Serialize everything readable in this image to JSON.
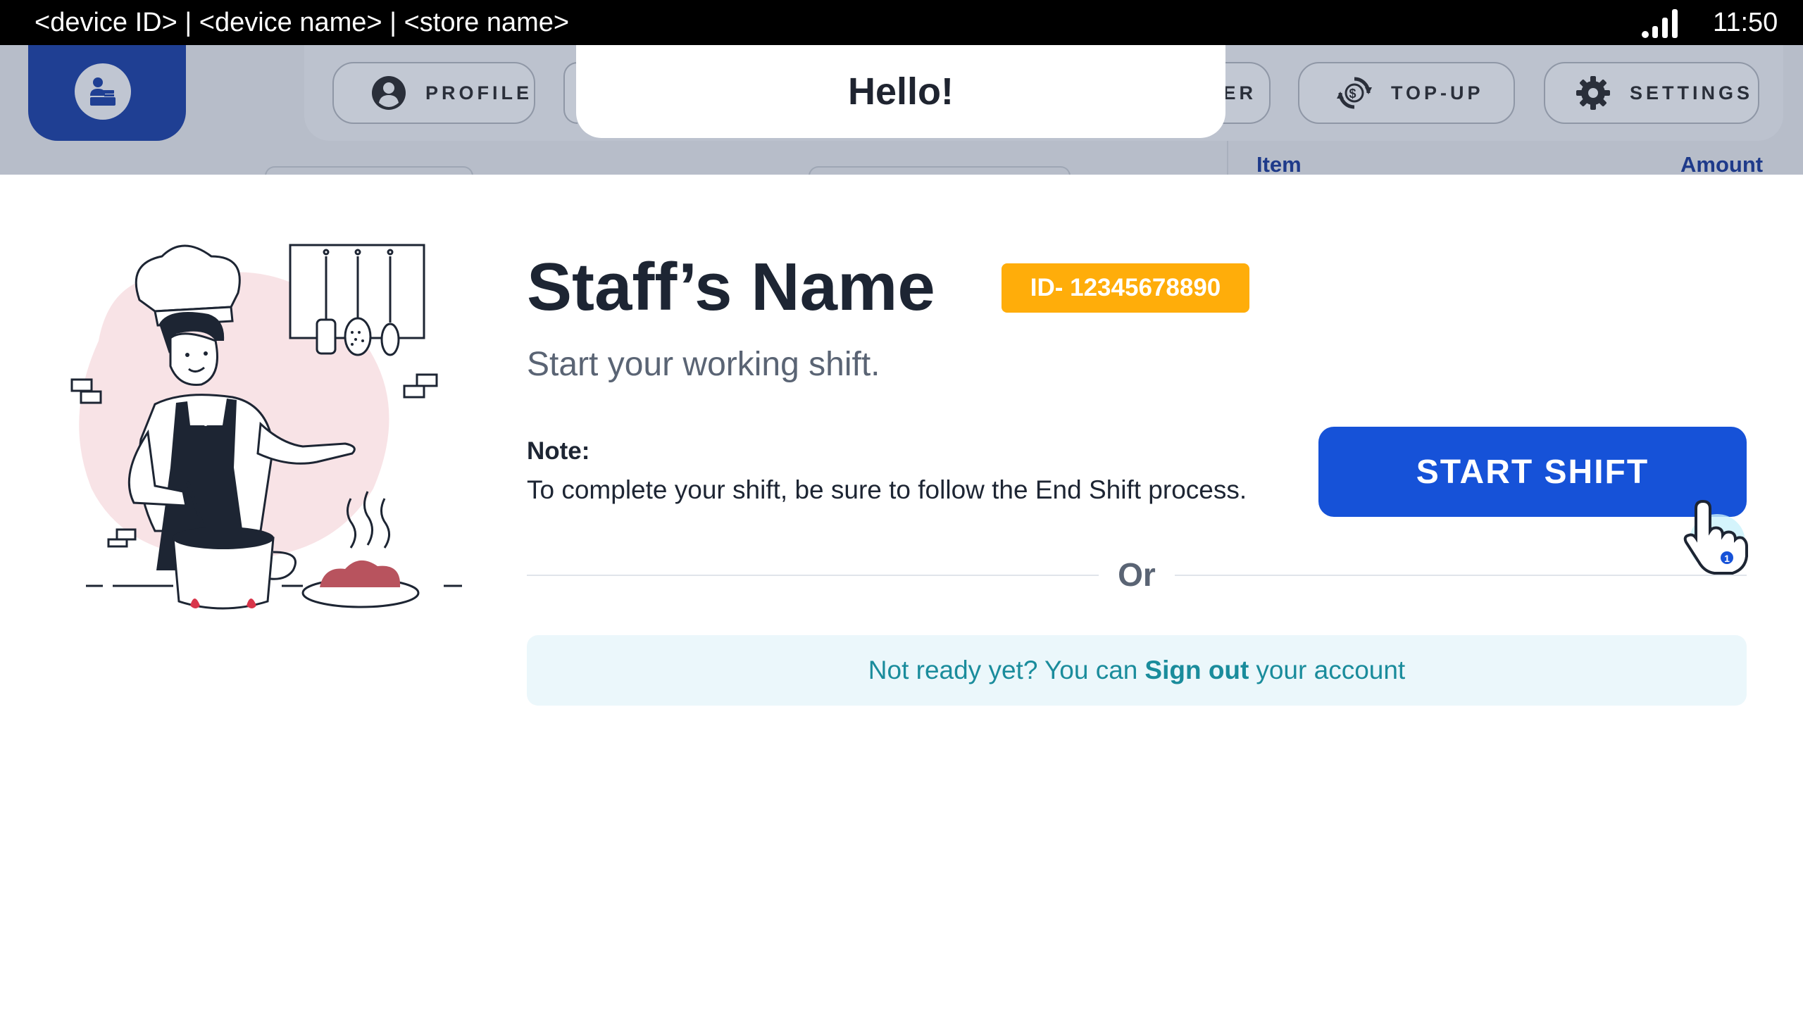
{
  "status_bar": {
    "device_info": "<device ID> | <device name> | <store name>",
    "time": "11:50"
  },
  "background_app": {
    "nav": {
      "profile_label": "PROFILE",
      "order_label_partial": "DER",
      "topup_label": "TOP-UP",
      "settings_label": "SETTINGS"
    },
    "order_columns": {
      "item": "Item",
      "amount": "Amount"
    }
  },
  "greeting": "Hello!",
  "shift": {
    "staff_name": "Staff’s Name",
    "staff_id": "ID- 12345678890",
    "subtitle": "Start your working shift.",
    "note_label": "Note:",
    "note_text": "To complete your shift, be sure to follow the End Shift process.",
    "start_button": "START SHIFT",
    "or_text": "Or",
    "signout_prefix": "Not ready yet? You can",
    "signout_link": "Sign out",
    "signout_suffix": "your account"
  },
  "colors": {
    "primary": "#1652d8",
    "badge": "#ffad0a",
    "text_dark": "#1d2533",
    "text_muted": "#5a6474",
    "teal": "#1a8c9c",
    "signout_bg": "#ebf7fb"
  },
  "icons": {
    "signal": "signal-icon",
    "logo": "cashier-icon",
    "profile": "user-circle-icon",
    "topup": "dollar-refresh-icon",
    "settings": "gear-icon",
    "tap_hint": "hand-pointer-icon"
  }
}
